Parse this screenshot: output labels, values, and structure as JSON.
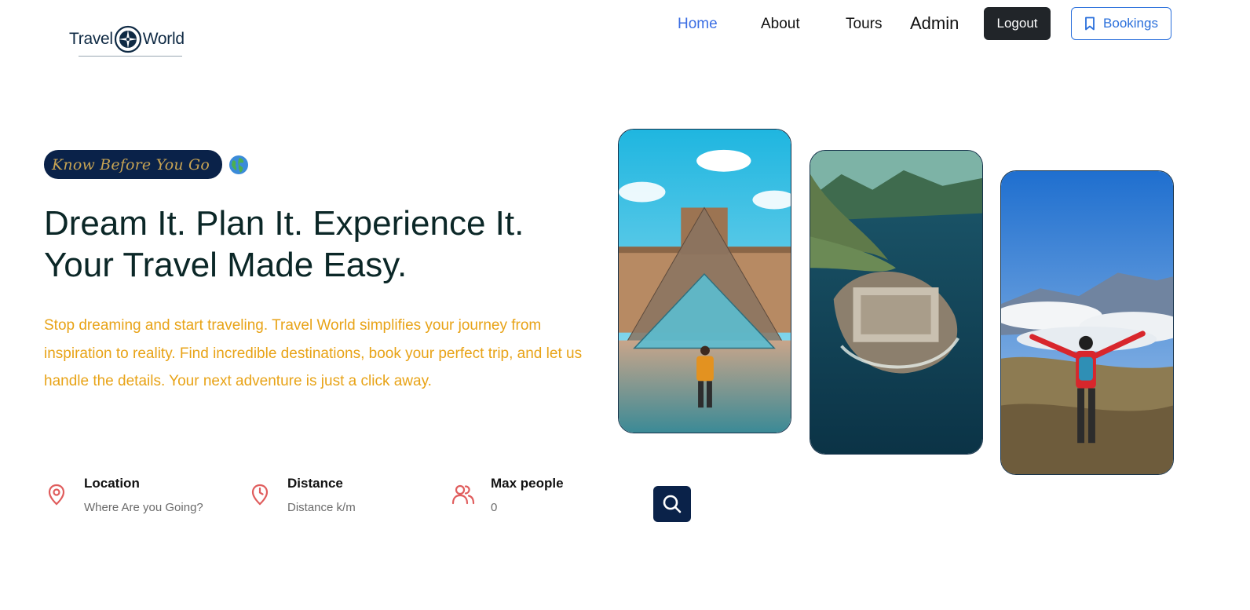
{
  "header": {
    "logo": {
      "word_left": "Travel",
      "word_right": "World"
    },
    "nav": [
      {
        "label": "Home",
        "active": true
      },
      {
        "label": "About",
        "active": false
      },
      {
        "label": "Tours",
        "active": false
      },
      {
        "label": "Admin",
        "active": false
      }
    ],
    "logout_label": "Logout",
    "bookings_label": "Bookings",
    "bookings_icon": "bookmark-icon"
  },
  "hero": {
    "subtitle": "Know Before You Go",
    "subtitle_icon": "globe-emoji",
    "title_line1": "Dream It. Plan It. Experience It.",
    "title_line2": "Your Travel Made Easy.",
    "description": "Stop dreaming and start traveling. Travel World simplifies your journey from inspiration to reality. Find incredible destinations, book your perfect trip, and let us handle the details. Your next adventure is just a click away.",
    "images": [
      "louvre-pyramid-photo",
      "island-fortress-photo",
      "mountain-hiker-photo"
    ]
  },
  "search": {
    "location": {
      "label": "Location",
      "placeholder": "Where Are you Going?",
      "icon": "map-pin-icon"
    },
    "distance": {
      "label": "Distance",
      "placeholder": "Distance k/m",
      "icon": "clock-icon"
    },
    "max_people": {
      "label": "Max people",
      "placeholder": "0",
      "icon": "users-icon"
    },
    "submit_icon": "search-icon"
  },
  "colors": {
    "primary_dark": "#0a2249",
    "accent": "#e8a317",
    "nav_active": "#3b6ee3",
    "icon_red": "#e05d5d"
  }
}
